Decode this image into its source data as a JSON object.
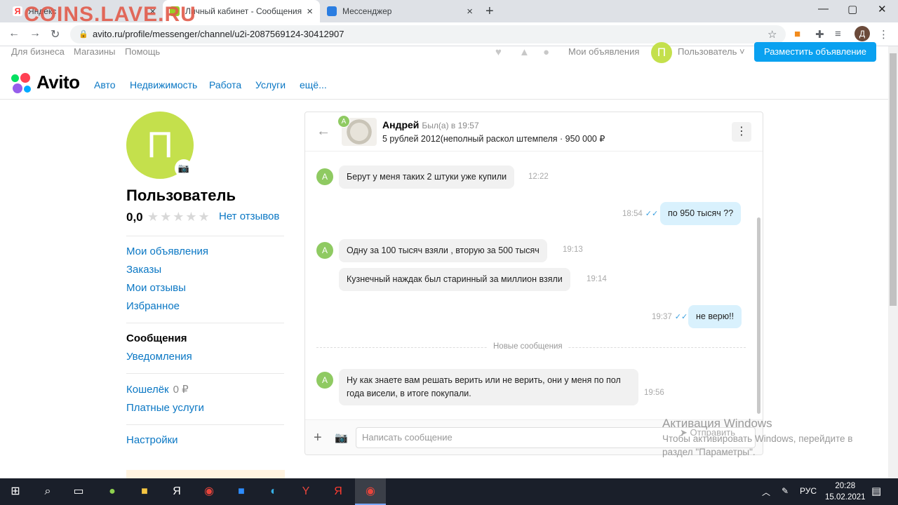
{
  "browser": {
    "watermark": "COINS.LAVE.RU",
    "tabs": [
      {
        "title": "Яндекс",
        "close": "×"
      },
      {
        "title": "Личный кабинет - Сообщения - ",
        "close": "×"
      },
      {
        "title": "Мессенджер",
        "close": "×"
      }
    ],
    "new_tab": "+",
    "window_controls": {
      "minimize": "—",
      "maximize": "▢",
      "close": "✕"
    },
    "url": "avito.ru/profile/messenger/channel/u2i-2087569124-30412907",
    "profile_initial": "Д"
  },
  "topline": {
    "links": [
      "Для бизнеса",
      "Магазины",
      "Помощь"
    ],
    "my_ads": "Мои объявления",
    "user_initial": "П",
    "user_label": "Пользователь",
    "post_button": "Разместить объявление"
  },
  "mainnav": {
    "logo": "Avito",
    "categories": [
      "Авто",
      "Недвижимость",
      "Работа",
      "Услуги",
      "ещё..."
    ]
  },
  "profile": {
    "initial": "П",
    "name": "Пользователь",
    "rating": "0,0",
    "stars": "★★★★★",
    "reviews_link": "Нет отзывов"
  },
  "sidebar": {
    "group1": [
      "Мои объявления",
      "Заказы",
      "Мои отзывы",
      "Избранное"
    ],
    "active": "Сообщения",
    "notifications": "Уведомления",
    "wallet": "Кошелёк",
    "wallet_value": "0 ₽",
    "paid": "Платные услуги",
    "settings": "Настройки"
  },
  "chat": {
    "peer_name": "Андрей",
    "peer_status": "Был(а) в 19:57",
    "peer_initial": "А",
    "item": "5 рублей 2012(неполный раскол штемпеля · 950 000 ₽",
    "messages": [
      {
        "dir": "in",
        "text": "Берут у меня таких 2 штуки уже купили",
        "time": "12:22"
      },
      {
        "dir": "out",
        "text": "по 950 тысяч ??",
        "time": "18:54"
      },
      {
        "dir": "in",
        "text": "Одну за 100 тысяч взяли , вторую за 500 тысяч",
        "time": "19:13"
      },
      {
        "dir": "in",
        "text": "Кузнечный наждак был старинный за миллион взяли",
        "time": "19:14"
      },
      {
        "dir": "out",
        "text": "не верю!!",
        "time": "19:37"
      },
      {
        "dir": "in",
        "text": "Ну как знаете вам решать верить или не верить, они у меня по пол года висели, в итоге покупали.",
        "time": "19:56"
      }
    ],
    "new_messages_label": "Новые сообщения",
    "input_placeholder": "Написать сообщение",
    "send_label": "Отправить"
  },
  "windows": {
    "activation_title": "Активация Windows",
    "activation_text": "Чтобы активировать Windows, перейдите в раздел \"Параметры\"."
  },
  "taskbar": {
    "lang": "РУС",
    "time": "20:28",
    "date": "15.02.2021"
  },
  "colors": {
    "accent": "#0aa1f0",
    "link": "#0a77c4",
    "avatar_green": "#c4e04c",
    "peer_green": "#8fca62",
    "out_bubble": "#d9f1fd"
  }
}
